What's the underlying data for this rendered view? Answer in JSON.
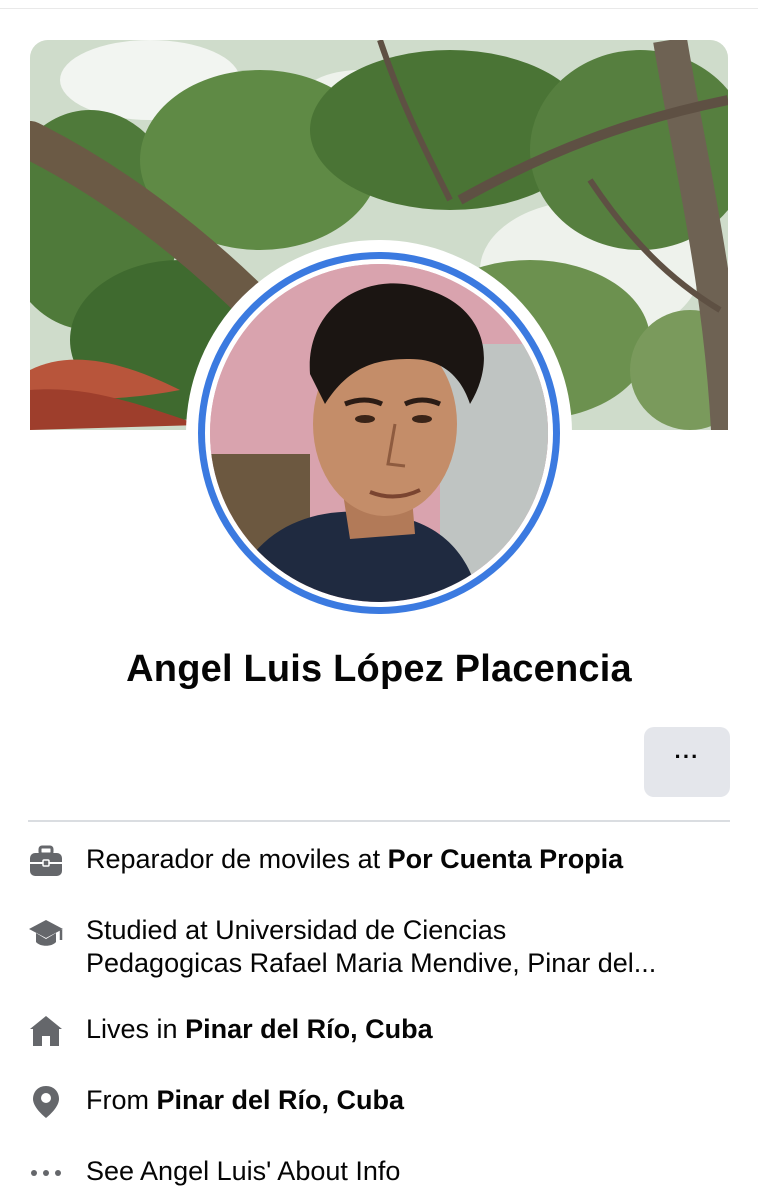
{
  "profile": {
    "name": "Angel Luis López Placencia",
    "more_label": "···"
  },
  "about": {
    "work": {
      "prefix": "Reparador de moviles at ",
      "place": "Por Cuenta Propia",
      "icon": "briefcase-icon"
    },
    "education": {
      "line1": "Studied at Universidad de Ciencias",
      "line2": "Pedagogicas Rafael Maria Mendive, Pinar del...",
      "icon": "graduation-cap-icon"
    },
    "lives": {
      "prefix": "Lives in ",
      "place": "Pinar del Río, Cuba",
      "icon": "home-icon"
    },
    "from": {
      "prefix": "From ",
      "place": "Pinar del Río, Cuba",
      "icon": "location-pin-icon"
    },
    "see_about": {
      "label": "See Angel Luis' About Info",
      "icon": "more-dots-icon"
    }
  },
  "colors": {
    "accent_ring": "#3b7ae0",
    "button_bg": "#e4e6eb",
    "icon_gray": "#65676b"
  }
}
